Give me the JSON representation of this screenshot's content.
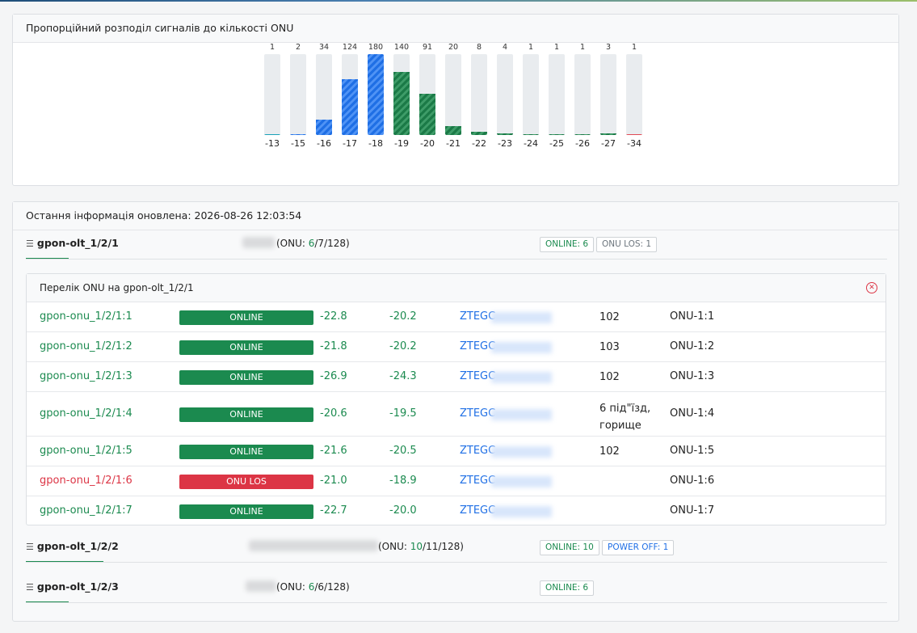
{
  "chart_card": {
    "title": "Пропорційний розподіл сигналів до кількості ONU"
  },
  "chart_data": {
    "type": "bar",
    "categories": [
      "-13",
      "-15",
      "-16",
      "-17",
      "-18",
      "-19",
      "-20",
      "-21",
      "-22",
      "-23",
      "-24",
      "-25",
      "-26",
      "-27",
      "-34"
    ],
    "values": [
      1,
      2,
      34,
      124,
      180,
      140,
      91,
      20,
      8,
      4,
      1,
      1,
      1,
      3,
      1
    ],
    "colors": [
      "#1aa1b8",
      "#1f6fe5",
      "#1f6fe5",
      "#1f6fe5",
      "#1f6fe5",
      "#1b7a47",
      "#1b7a47",
      "#1b7a47",
      "#1b7a47",
      "#1b7a47",
      "#1b7a47",
      "#1b7a47",
      "#1b7a47",
      "#1b7a47",
      "#e04a55"
    ],
    "ylim": [
      0,
      180
    ]
  },
  "info": {
    "updated": "Остання інформація оновлена: 2026-08-26 12:03:54",
    "olts": [
      {
        "name": "gpon-olt_1/2/1",
        "onu_prefix": "(ONU: ",
        "onu_online": "6",
        "onu_rest": "/7/128)",
        "badges": [
          {
            "label": "ONLINE: 6",
            "kind": "green"
          },
          {
            "label": "ONU LOS: 1",
            "kind": "gray"
          }
        ]
      },
      {
        "name": "gpon-olt_1/2/2",
        "onu_prefix": "(ONU: ",
        "onu_online": "10",
        "onu_rest": "/11/128)",
        "badges": [
          {
            "label": "ONLINE: 10",
            "kind": "green"
          },
          {
            "label": "POWER OFF: 1",
            "kind": "blue"
          }
        ]
      },
      {
        "name": "gpon-olt_1/2/3",
        "onu_prefix": "(ONU: ",
        "onu_online": "6",
        "onu_rest": "/6/128)",
        "badges": [
          {
            "label": "ONLINE: 6",
            "kind": "green"
          }
        ]
      }
    ]
  },
  "onu_list": {
    "title": "Перелік ONU на gpon-olt_1/2/1",
    "rows": [
      {
        "id": "gpon-onu_1/2/1:1",
        "status": "ONLINE",
        "rx": "-22.8",
        "tx": "-20.2",
        "serial": "ZTEGC",
        "addr": "102",
        "desc": "ONU-1:1"
      },
      {
        "id": "gpon-onu_1/2/1:2",
        "status": "ONLINE",
        "rx": "-21.8",
        "tx": "-20.2",
        "serial": "ZTEGC",
        "addr": "103",
        "desc": "ONU-1:2"
      },
      {
        "id": "gpon-onu_1/2/1:3",
        "status": "ONLINE",
        "rx": "-26.9",
        "tx": "-24.3",
        "serial": "ZTEGC",
        "addr": "102",
        "desc": "ONU-1:3"
      },
      {
        "id": "gpon-onu_1/2/1:4",
        "status": "ONLINE",
        "rx": "-20.6",
        "tx": "-19.5",
        "serial": "ZTEGC",
        "addr": "6 під\"їзд,",
        "addr2": "горище",
        "desc": "ONU-1:4"
      },
      {
        "id": "gpon-onu_1/2/1:5",
        "status": "ONLINE",
        "rx": "-21.6",
        "tx": "-20.5",
        "serial": "ZTEGC",
        "addr": "102",
        "desc": "ONU-1:5"
      },
      {
        "id": "gpon-onu_1/2/1:6",
        "status": "ONU LOS",
        "rx": "-21.0",
        "tx": "-18.9",
        "serial": "ZTEGC",
        "addr": "",
        "desc": "ONU-1:6"
      },
      {
        "id": "gpon-onu_1/2/1:7",
        "status": "ONLINE",
        "rx": "-22.7",
        "tx": "-20.0",
        "serial": "ZTEGC",
        "addr": "",
        "desc": "ONU-1:7"
      }
    ]
  }
}
